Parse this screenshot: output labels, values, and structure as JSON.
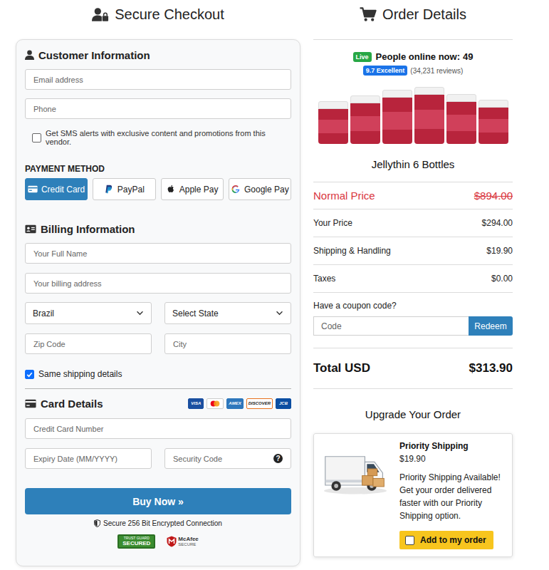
{
  "checkout": {
    "title": "Secure Checkout"
  },
  "customer": {
    "title": "Customer Information",
    "fields": [
      {
        "placeholder": "Email address"
      },
      {
        "placeholder": "Phone"
      }
    ],
    "sms": {
      "label": "Get SMS alerts with exclusive content and promotions from this vendor.",
      "checked": false
    }
  },
  "payment": {
    "title": "PAYMENT METHOD",
    "methods": [
      {
        "label": "Credit Card",
        "kind": "card",
        "selected": true
      },
      {
        "label": "PayPal",
        "kind": "paypal",
        "selected": false
      },
      {
        "label": "Apple Pay",
        "kind": "apple",
        "selected": false
      },
      {
        "label": "Google Pay",
        "kind": "google",
        "selected": false
      }
    ]
  },
  "billing": {
    "title": "Billing Information",
    "fields": [
      {
        "placeholder": "Your Full Name"
      },
      {
        "placeholder": "Your billing address"
      }
    ],
    "country": "Brazil",
    "state": "Select State",
    "zip": {
      "placeholder": "Zip Code"
    },
    "city": {
      "placeholder": "City"
    },
    "same_shipping": {
      "label": "Same shipping details",
      "checked": true
    }
  },
  "card": {
    "title": "Card Details",
    "brands": [
      {
        "kind": "wordmark",
        "label": "VISA",
        "color": "#1a4fa0"
      },
      {
        "kind": "circles",
        "color": "#ffffff"
      },
      {
        "kind": "wordmark",
        "label": "AMEX",
        "color": "#2e77bc"
      },
      {
        "kind": "wordmark",
        "label": "DISCOVER",
        "color": "#e8731f"
      },
      {
        "kind": "wordmark",
        "label": "JCB",
        "color": "#0b4ea2"
      }
    ],
    "number": {
      "placeholder": "Credit Card Number"
    },
    "expiry": {
      "placeholder": "Expiry Date (MM/YYYY)"
    },
    "cvv": {
      "placeholder": "Security Code",
      "help": "?"
    }
  },
  "buy": "Buy Now »",
  "secure_note": "Secure 256 Bit Encrypted Connection",
  "trust_badges": [
    {
      "kind": "trustguard",
      "label": "SECURED",
      "sub": "TRUST GUARD"
    },
    {
      "kind": "mcafee",
      "label": "McAfee",
      "sub": "SECURE"
    }
  ],
  "order": {
    "title": "Order Details",
    "live": {
      "badge": "Live",
      "label": "People online now:",
      "count": "49"
    },
    "rating": {
      "badge": "9.7 Excellent",
      "reviews": "(34,231 reviews)"
    },
    "product": {
      "name": "Jellythin 6 Bottles"
    },
    "normal_price": {
      "label": "Normal Price",
      "value": "$894.00"
    },
    "lines": [
      {
        "label": "Your Price",
        "value": "$294.00"
      },
      {
        "label": "Shipping & Handling",
        "value": "$19.90"
      },
      {
        "label": "Taxes",
        "value": "$0.00"
      }
    ],
    "coupon": {
      "label": "Have a coupon code?",
      "placeholder": "Code",
      "button": "Redeem"
    },
    "total": {
      "label": "Total USD",
      "value": "$313.90"
    },
    "upgrade": {
      "title": "Upgrade Your Order",
      "offer": {
        "title": "Priority Shipping",
        "price": "$19.90",
        "description": "Priority Shipping Available! Get your order delivered faster with our Priority Shipping option.",
        "button": "Add to my order",
        "checked": false
      }
    }
  }
}
